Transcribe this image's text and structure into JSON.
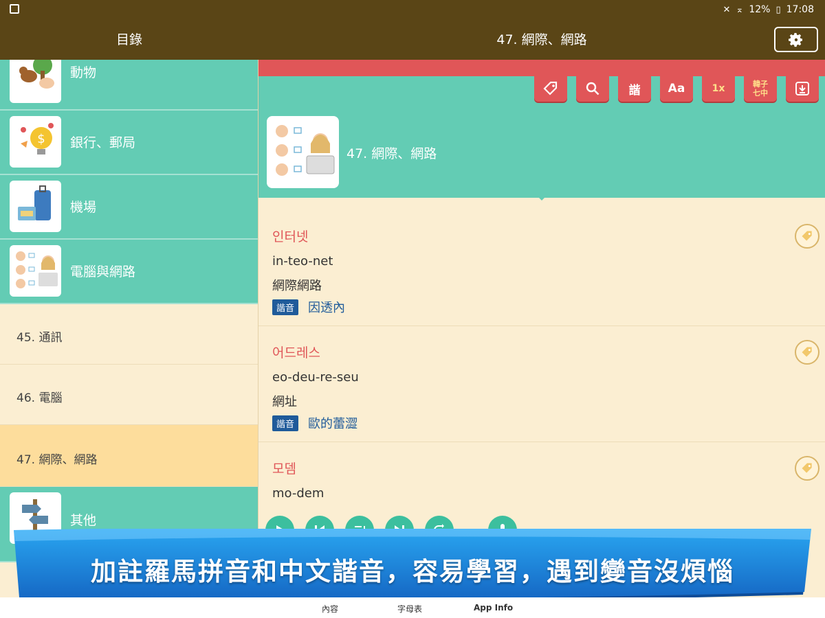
{
  "statusbar": {
    "battery": "12%",
    "time": "17:08"
  },
  "header": {
    "sidebar_title": "目錄",
    "main_title": "47. 網際、網路"
  },
  "sidebar": {
    "categories": [
      {
        "label": "動物"
      },
      {
        "label": "銀行、郵局"
      },
      {
        "label": "機場"
      },
      {
        "label": "電腦與網路"
      }
    ],
    "lessons": [
      {
        "label": "45. 通訊"
      },
      {
        "label": "46. 電腦"
      },
      {
        "label": "47. 網際、網路"
      }
    ],
    "last_category": {
      "label": "其他"
    }
  },
  "toolbar": {
    "phonetic_label": "諧",
    "font_label": "Aa",
    "speed_label": "1x",
    "lang_top": "韓子",
    "lang_bottom": "七中"
  },
  "lesson": {
    "title": "47. 網際、網路"
  },
  "entries": [
    {
      "korean": "인터넷",
      "romanization": "in-teo-net",
      "chinese": "網際網路",
      "badge": "諧音",
      "phonetic": "因透內"
    },
    {
      "korean": "어드레스",
      "romanization": "eo-deu-re-seu",
      "chinese": "網址",
      "badge": "諧音",
      "phonetic": "歐的蕾澀"
    },
    {
      "korean": "모뎀",
      "romanization": "mo-dem"
    }
  ],
  "banner": {
    "text": "加註羅馬拼音和中文諧音，容易學習，遇到變音沒煩惱"
  },
  "bottom_tabs": [
    {
      "label": "內容"
    },
    {
      "label": "字母表"
    },
    {
      "label": "App Info"
    }
  ],
  "colors": {
    "header": "#5a4516",
    "teal": "#63ccb4",
    "red": "#e05658",
    "cream": "#fbeed2",
    "banner": "#1e8fe0"
  }
}
